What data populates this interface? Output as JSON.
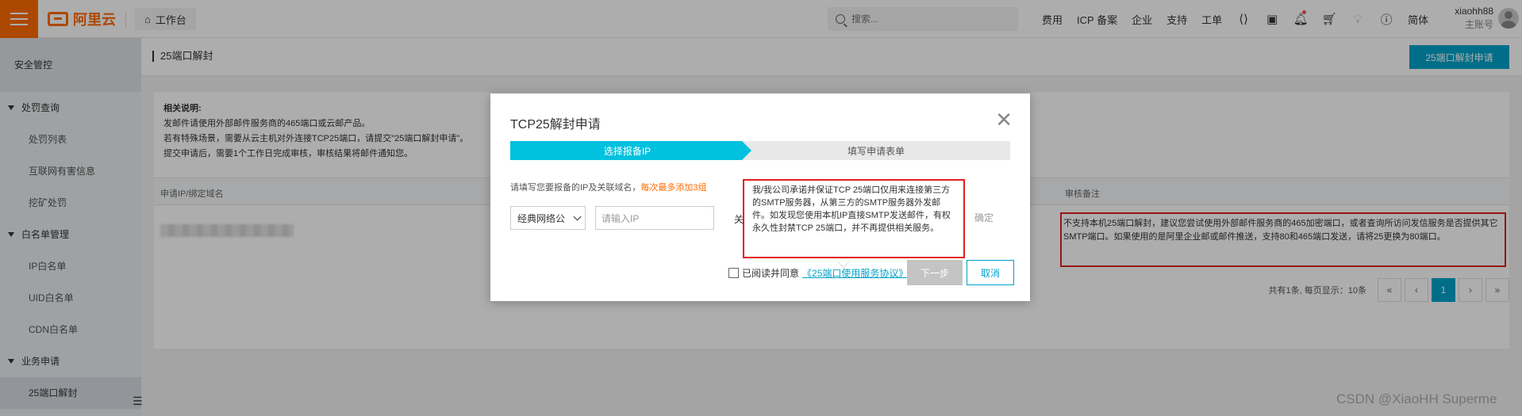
{
  "topbar": {
    "logo_text": "阿里云",
    "workbench_label": "工作台",
    "search_placeholder": "搜索...",
    "nav_links": [
      "费用",
      "ICP 备案",
      "企业",
      "支持",
      "工单"
    ],
    "lang_label": "简体",
    "username": "xiaohh88",
    "account_type": "主账号",
    "accent_color": "#ff6a00"
  },
  "sidebar": {
    "title": "安全管控",
    "groups": [
      {
        "label": "处罚查询",
        "items": [
          "处罚列表",
          "互联网有害信息",
          "挖矿处罚"
        ]
      },
      {
        "label": "白名单管理",
        "items": [
          "IP白名单",
          "UID白名单",
          "CDN白名单"
        ]
      },
      {
        "label": "业务申请",
        "items": [
          "25端口解封"
        ]
      }
    ]
  },
  "page": {
    "title": "25端口解封",
    "apply_button": "25端口解封申请",
    "primary_color": "#00a2ca"
  },
  "notice": {
    "heading": "相关说明:",
    "lines": [
      "发邮件请使用外部邮件服务商的465端口或云邮产品。",
      "若有特殊场景，需要从云主机对外连接TCP25端口，请提交\"25端口解封申请\"。",
      "提交申请后，需要1个工作日完成审核，审核结果将邮件通知您。"
    ]
  },
  "table": {
    "col_ip": "申请IP/绑定域名",
    "col_remark": "审核备注",
    "remark_text": "不支持本机25端口解封，建议您尝试使用外部邮件服务商的465加密端口，或者查询所访问发信服务是否提供其它SMTP端口。如果使用的是阿里企业邮或邮件推送，支持80和465端口发送，请将25更换为80端口。"
  },
  "pagination": {
    "info": "共有1条, 每页显示：10条",
    "first": "«",
    "prev": "‹",
    "current": "1",
    "next": "›",
    "last": "»"
  },
  "modal": {
    "title": "TCP25解封申请",
    "close_symbol": "✕",
    "step1": "选择报备IP",
    "step2": "填写申请表单",
    "hint": "请填写您要报备的IP及关联域名，",
    "hint_warn": "每次最多添加3组",
    "region_value": "经典网络公",
    "ip_placeholder": "请输入IP",
    "partial_char": "关",
    "confirm_label": "确定",
    "popover_text": "我/我公司承诺并保证TCP 25端口仅用来连接第三方的SMTP服务器，从第三方的SMTP服务器外发邮件。如发现您使用本机IP直接SMTP发送邮件，有权永久性封禁TCP 25端口，并不再提供相关服务。",
    "agree_text": "已阅读并同意",
    "agree_link": "《25端口使用服务协议》",
    "next_button": "下一步",
    "cancel_button": "取消"
  },
  "watermark": "CSDN @XiaoHH Superme"
}
